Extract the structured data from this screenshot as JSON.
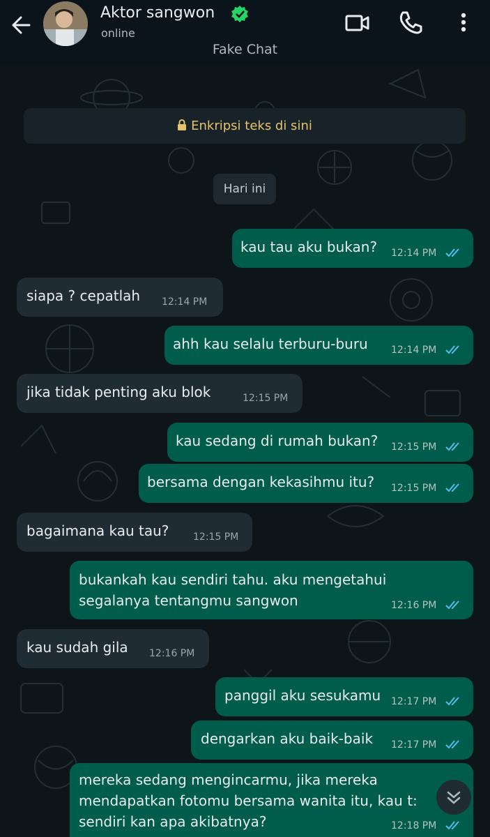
{
  "header": {
    "contact_name": "Aktor sangwon",
    "status": "online",
    "subtitle": "Fake Chat",
    "icons": [
      "back-arrow-icon",
      "verified-badge-icon",
      "video-call-icon",
      "phone-call-icon",
      "more-vert-icon"
    ]
  },
  "banner": {
    "text": "Enkripsi teks di sini",
    "icon": "lock-icon"
  },
  "date_chip": "Hari ini",
  "messages": [
    {
      "dir": "out",
      "text": "kau tau aku bukan?",
      "time": "12:14 PM",
      "read": true
    },
    {
      "dir": "in",
      "text": "siapa ? cepatlah",
      "time": "12:14 PM"
    },
    {
      "dir": "out",
      "text": "ahh kau selalu terburu-buru",
      "time": "12:14 PM",
      "read": true
    },
    {
      "dir": "in",
      "text": "jika tidak penting aku blok",
      "time": "12:15 PM"
    },
    {
      "dir": "out",
      "text": "kau sedang di rumah bukan?",
      "time": "12:15 PM",
      "read": true
    },
    {
      "dir": "out",
      "text": "bersama dengan kekasihmu itu?",
      "time": "12:15 PM",
      "read": true
    },
    {
      "dir": "in",
      "text": "bagaimana kau tau?",
      "time": "12:15 PM"
    },
    {
      "dir": "out",
      "text": "bukankah kau sendiri tahu. aku mengetahui\nsegalanya tentangmu sangwon",
      "time": "12:16 PM",
      "read": true
    },
    {
      "dir": "in",
      "text": "kau sudah gila",
      "time": "12:16 PM"
    },
    {
      "dir": "out",
      "text": "panggil aku sesukamu",
      "time": "12:17 PM",
      "read": true
    },
    {
      "dir": "out",
      "text": "dengarkan aku baik-baik",
      "time": "12:17 PM",
      "read": true
    },
    {
      "dir": "out",
      "text": "mereka sedang mengincarmu, jika mereka\nmendapatkan fotomu bersama wanita itu, kau t:\nsendiri kan apa akibatnya?",
      "time": "12:18 PM",
      "read": true
    }
  ],
  "colors": {
    "outgoing_bubble": "#005c4b",
    "incoming_bubble": "#1f2c34",
    "read_ticks": "#53bdeb",
    "verified": "#25d366",
    "banner_text": "#e6c36a"
  },
  "scroll_button_icon": "double-chevron-down-icon"
}
